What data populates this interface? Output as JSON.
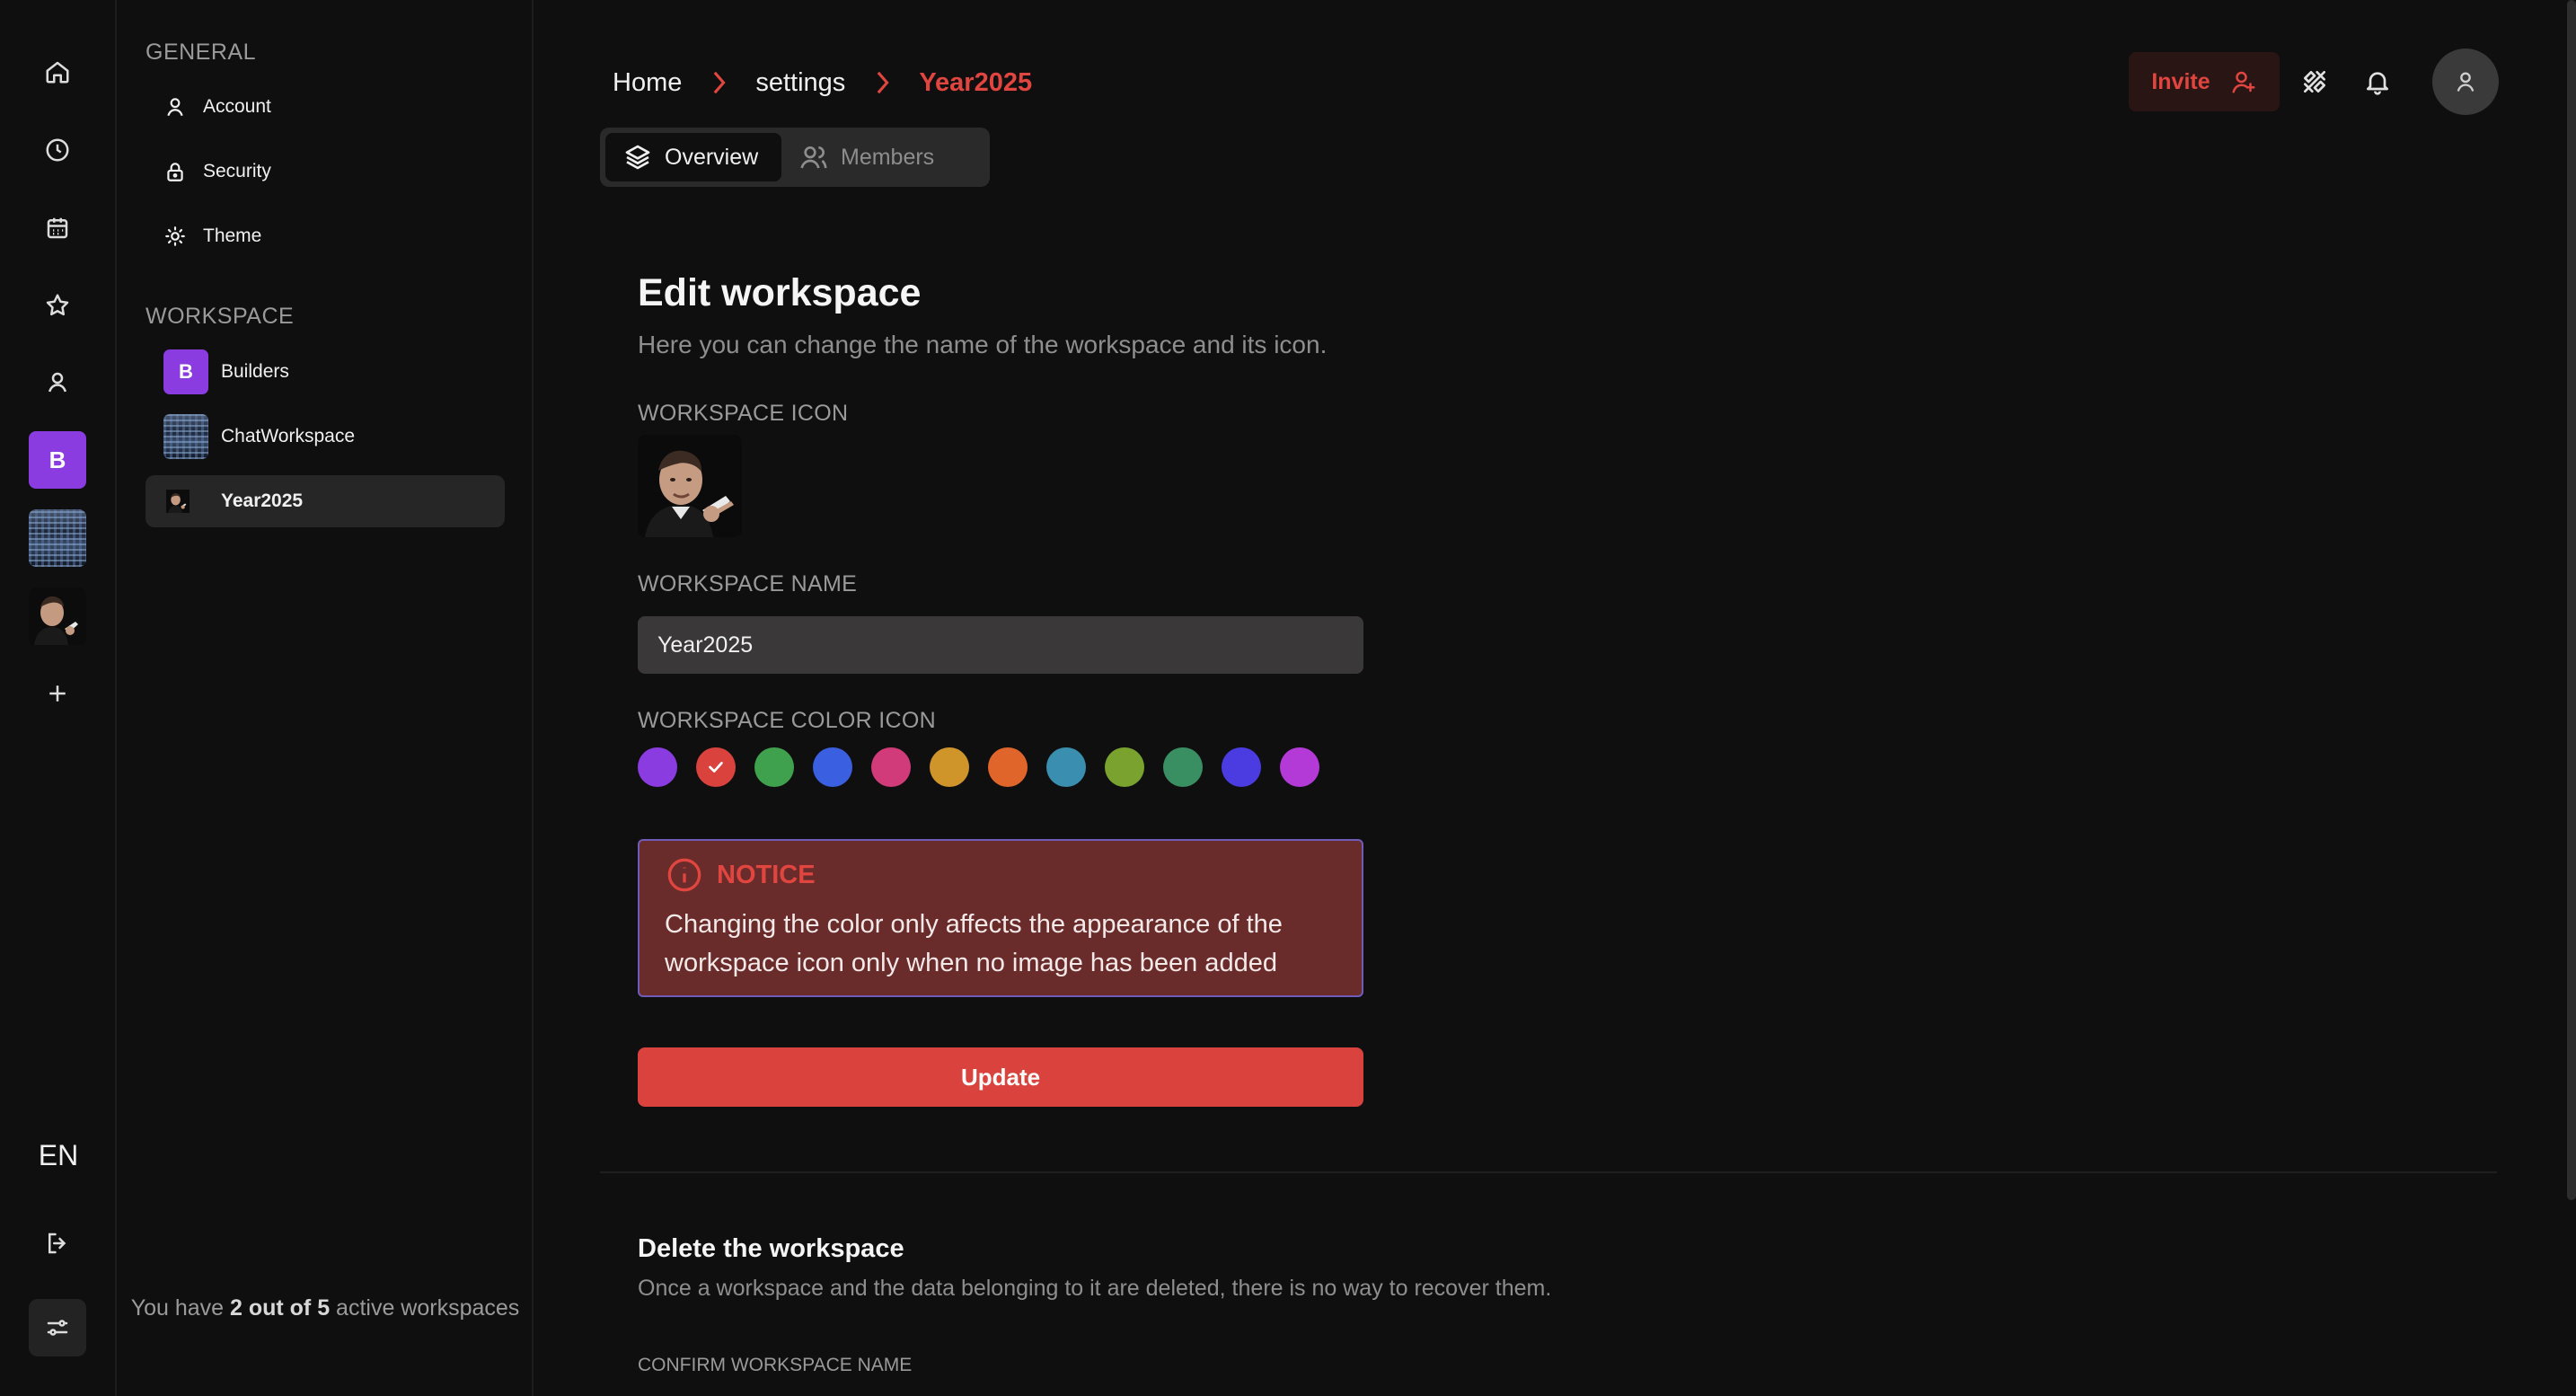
{
  "rail": {
    "items": [
      {
        "name": "home",
        "icon": "home-icon"
      },
      {
        "name": "history",
        "icon": "clock-icon"
      },
      {
        "name": "calendar",
        "icon": "calendar-icon"
      },
      {
        "name": "favorites",
        "icon": "star-icon"
      },
      {
        "name": "profile",
        "icon": "user-icon"
      }
    ],
    "workspace_letter": "B",
    "add_icon": "plus-icon",
    "language": "EN",
    "logout_icon": "logout-icon",
    "settings_icon": "sliders-icon"
  },
  "sidebar": {
    "general_title": "GENERAL",
    "general_items": [
      {
        "label": "Account",
        "icon": "user-icon"
      },
      {
        "label": "Security",
        "icon": "lock-icon"
      },
      {
        "label": "Theme",
        "icon": "sun-icon"
      }
    ],
    "workspace_title": "WORKSPACE",
    "workspaces": [
      {
        "label": "Builders",
        "letter": "B",
        "color": "#8a3ce0"
      },
      {
        "label": "ChatWorkspace"
      },
      {
        "label": "Year2025",
        "active": true
      }
    ],
    "footer_prefix": "You have ",
    "footer_count": "2 out of 5",
    "footer_suffix": " active workspaces"
  },
  "header": {
    "breadcrumb": [
      "Home",
      "settings",
      "Year2025"
    ],
    "invite_label": "Invite",
    "icons": [
      "invite-user-icon",
      "tools-icon",
      "bell-icon",
      "avatar-icon"
    ]
  },
  "tabs": [
    {
      "label": "Overview",
      "icon": "layers-icon",
      "active": true
    },
    {
      "label": "Members",
      "icon": "users-icon",
      "active": false
    }
  ],
  "edit": {
    "title": "Edit workspace",
    "subtitle": "Here you can change the name of the workspace and its icon.",
    "icon_label": "WORKSPACE ICON",
    "name_label": "WORKSPACE NAME",
    "name_value": "Year2025",
    "color_label": "WORKSPACE COLOR ICON",
    "colors": [
      "#8a3ce0",
      "#d9423d",
      "#3fa04e",
      "#3a5fe0",
      "#d23b79",
      "#cf952b",
      "#e0652a",
      "#3a8fb0",
      "#7aa22e",
      "#3a8f62",
      "#4a3ce0",
      "#b33ad6"
    ],
    "selected_color_index": 1,
    "notice_title": "NOTICE",
    "notice_text": "Changing the color only affects the appearance of the workspace icon only when no image has been added",
    "update_label": "Update"
  },
  "delete": {
    "title": "Delete the workspace",
    "description": "Once a workspace and the data belonging to it are deleted, there is no way to recover them.",
    "confirm_label": "CONFIRM WORKSPACE NAME"
  }
}
